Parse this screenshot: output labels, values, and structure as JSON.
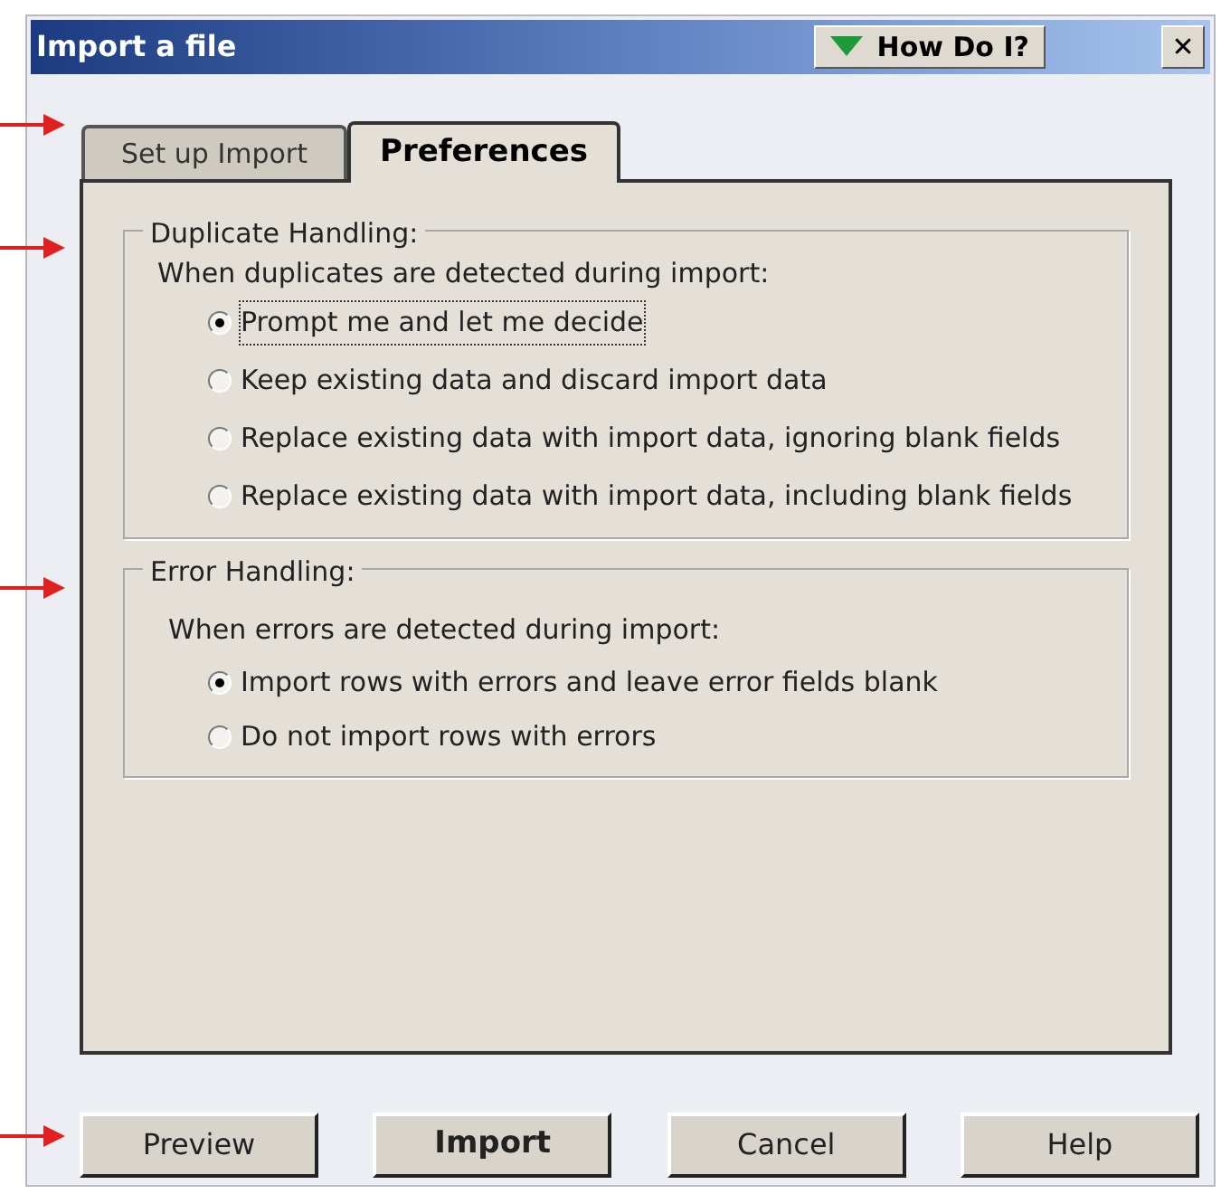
{
  "window": {
    "title": "Import a file",
    "help_button": "How Do I?",
    "close_button": "✕"
  },
  "tabs": [
    {
      "label": "Set up Import",
      "selected": false
    },
    {
      "label": "Preferences",
      "selected": true
    }
  ],
  "groups": [
    {
      "title": "Duplicate Handling:",
      "prompt": "When duplicates are detected during import:",
      "options": [
        {
          "label": "Prompt me and let me decide",
          "selected": true
        },
        {
          "label": "Keep existing data and discard import data",
          "selected": false
        },
        {
          "label": "Replace existing data with import data, ignoring blank fields",
          "selected": false
        },
        {
          "label": "Replace existing data with import data, including blank fields",
          "selected": false
        }
      ]
    },
    {
      "title": "Error Handling:",
      "prompt": "When errors are detected during import:",
      "options": [
        {
          "label": "Import rows with errors and leave error fields blank",
          "selected": true
        },
        {
          "label": "Do not import rows with errors",
          "selected": false
        }
      ]
    }
  ],
  "buttons": [
    {
      "label": "Preview",
      "default": false
    },
    {
      "label": "Import",
      "default": true
    },
    {
      "label": "Cancel",
      "default": false
    },
    {
      "label": "Help",
      "default": false
    }
  ]
}
